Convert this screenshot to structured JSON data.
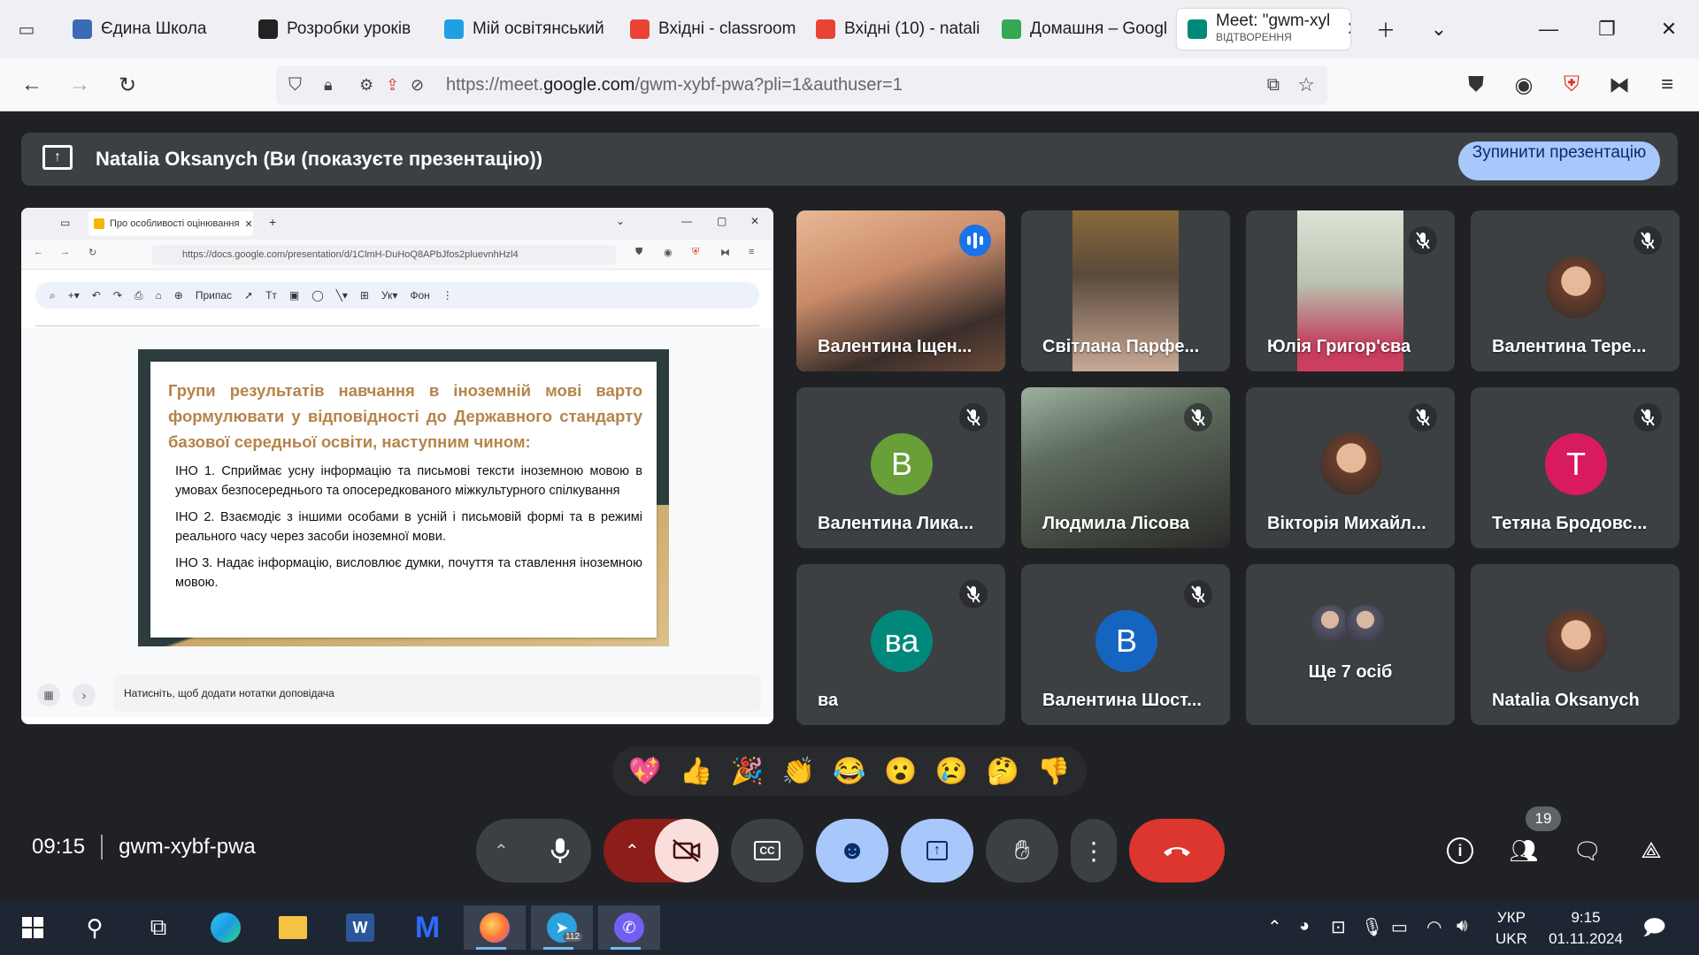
{
  "browser": {
    "tabs": [
      {
        "label": "Єдина Школа",
        "icon": "school-icon",
        "color": "#3b6bb5"
      },
      {
        "label": "Розробки уроків",
        "icon": "mortarboard-icon",
        "color": "#222222"
      },
      {
        "label": "Мій освітянський",
        "icon": "snowflake-icon",
        "color": "#1ea0e3"
      },
      {
        "label": "Вхідні - classroom",
        "icon": "gmail-icon",
        "color": "#ea4335"
      },
      {
        "label": "Вхідні (10) - natali",
        "icon": "gmail-icon",
        "color": "#ea4335"
      },
      {
        "label": "Домашня – Googl",
        "icon": "drive-icon",
        "color": "#34a853"
      },
      {
        "label": "Meet: \"gwm-xyl",
        "sublabel": "ВІДТВОРЕННЯ",
        "icon": "meet-icon",
        "color": "#00897b"
      }
    ],
    "url_prefix": "https://meet.",
    "url_domain": "google.com",
    "url_path": "/gwm-xybf-pwa?pli=1&authuser=1"
  },
  "meet": {
    "presenting_title": "Natalia Oksanych (Ви (показуєте презентацію))",
    "stop_button": "Зупинити презентацію",
    "meeting_time": "09:15",
    "meeting_code": "gwm-xybf-pwa",
    "participants_count": "19",
    "tiles": [
      {
        "name": "Валентина Іщен...",
        "kind": "video",
        "state": "speaking",
        "active": true
      },
      {
        "name": "Світлана Парфе...",
        "kind": "video",
        "state": "none"
      },
      {
        "name": "Юлія Григор'єва",
        "kind": "video",
        "state": "muted"
      },
      {
        "name": "Валентина Тере...",
        "kind": "photo",
        "state": "muted"
      },
      {
        "name": "Валентина Лика...",
        "kind": "letter",
        "letter": "В",
        "color": "#689f38",
        "state": "muted"
      },
      {
        "name": "Людмила Лісова",
        "kind": "video",
        "state": "muted"
      },
      {
        "name": "Вікторія Михайл...",
        "kind": "photo",
        "state": "muted"
      },
      {
        "name": "Тетяна Бродовс...",
        "kind": "letter",
        "letter": "Т",
        "color": "#d81b60",
        "state": "muted"
      },
      {
        "name": "ва",
        "kind": "letter",
        "letter": "ва",
        "color": "#00897b",
        "state": "muted"
      },
      {
        "name": "Валентина Шост...",
        "kind": "letter",
        "letter": "В",
        "color": "#1565c0",
        "state": "muted"
      },
      {
        "name": "Ще 7 осіб",
        "kind": "more",
        "state": "none"
      },
      {
        "name": "Natalia Oksanych",
        "kind": "photo",
        "state": "none"
      }
    ],
    "reactions": [
      "💖",
      "👍",
      "🎉",
      "👏",
      "😂",
      "😮",
      "😢",
      "🤔",
      "👎"
    ]
  },
  "presentation": {
    "tab_title": "Про особливості оцінювання",
    "url": "https://docs.google.com/presentation/d/1ClmH-DuHoQ8APbJfos2pluevnhHzl4",
    "toolbar_preset": "Припас",
    "toolbar_bg": "Фон",
    "slide_heading": "Групи результатів навчання в іноземній мові варто формулювати у відповідності до Державного стандарту базової середньої освіти, наступним чином:",
    "slide_items": [
      "ІНО 1.   Сприймає усну інформацію та письмові тексти іноземною мовою в умовах безпосереднього та опосередкованого міжкультурного спілкування",
      "ІНО 2.  Взаємодіє з іншими особами в усній і письмовій формі та в режимі  реального часу через засоби іноземної мови.",
      "ІНО 3.  Надає інформацію, висловлює думки, почуття та ставлення іноземною мовою."
    ],
    "notes_placeholder": "Натисніть, щоб додати нотатки доповідача"
  },
  "taskbar": {
    "lang_top": "УКР",
    "lang_bottom": "UKR",
    "time": "9:15",
    "date": "01.11.2024",
    "telegram_badge": "112"
  }
}
